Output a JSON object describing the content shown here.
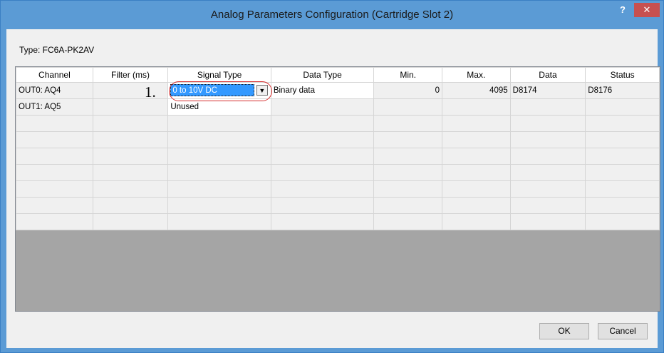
{
  "window": {
    "title": "Analog Parameters Configuration (Cartridge Slot 2)",
    "help_glyph": "?",
    "close_glyph": "✕"
  },
  "type_label": "Type: FC6A-PK2AV",
  "grid": {
    "headers": [
      "Channel",
      "Filter (ms)",
      "Signal Type",
      "Data Type",
      "Min.",
      "Max.",
      "Data",
      "Status"
    ],
    "rows": [
      {
        "channel": "OUT0: AQ4",
        "filter": "",
        "signal_type": "0 to 10V DC",
        "data_type": "Binary data",
        "min": "0",
        "max": "4095",
        "data": "D8174",
        "status": "D8176"
      },
      {
        "channel": "OUT1: AQ5",
        "filter": "",
        "signal_type": "Unused",
        "data_type": "",
        "min": "",
        "max": "",
        "data": "",
        "status": ""
      }
    ]
  },
  "annotation": "1.",
  "buttons": {
    "ok": "OK",
    "cancel": "Cancel"
  },
  "colors": {
    "title_bar": "#5b9bd5",
    "selection": "#3399ff",
    "annotation_ring": "#d63030",
    "close_button": "#c75050"
  }
}
